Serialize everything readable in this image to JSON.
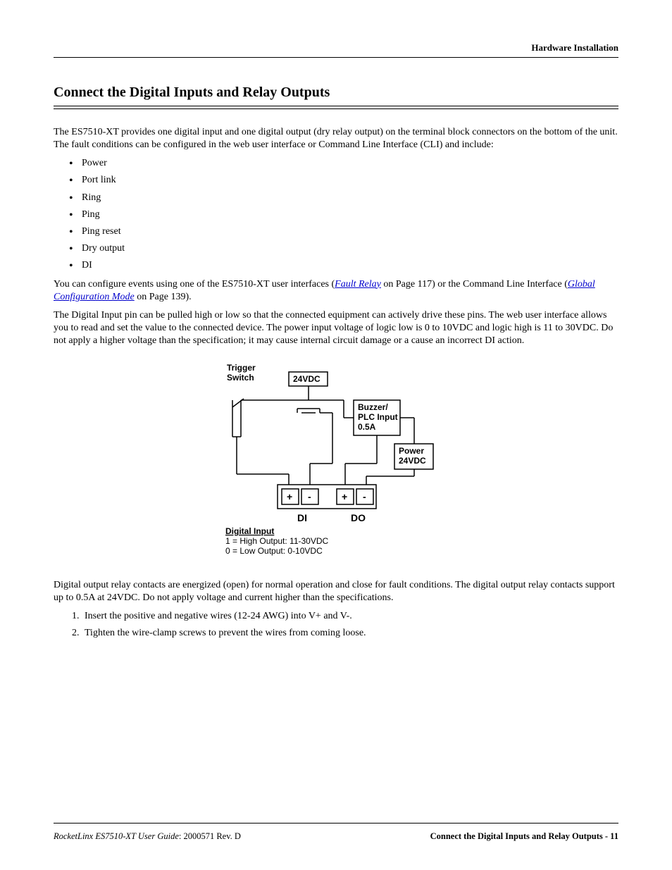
{
  "header": {
    "chapter": "Hardware Installation"
  },
  "section": {
    "title": "Connect the Digital Inputs and Relay Outputs"
  },
  "paras": {
    "intro": "The ES7510-XT provides one digital input and one digital output (dry relay output) on the terminal block connectors on the bottom of the unit. The fault conditions can be configured in the web user interface or Command Line Interface (CLI) and include:",
    "configA": "You can configure events using one of the ES7510-XT user interfaces (",
    "configB": " on Page 117) or the Command Line Interface (",
    "configC": " on Page 139).",
    "digitalInput": "The Digital Input pin can be pulled high or low so that the connected equipment can actively drive these pins. The web user interface allows you to read and set the value to the connected device. The power input voltage of logic low is 0 to 10VDC and logic high is 11 to 30VDC. Do not apply a higher voltage than the specification; it may cause internal circuit damage or a cause an incorrect DI action.",
    "relay": "Digital output relay contacts are energized (open) for normal operation and close for fault conditions. The digital output relay contacts support up to 0.5A at 24VDC. Do not apply voltage and current higher than the specifications."
  },
  "bullets": [
    "Power",
    "Port link",
    "Ring",
    "Ping",
    "Ping reset",
    "Dry output",
    "DI"
  ],
  "links": {
    "faultRelay": "Fault Relay",
    "globalConfig": "Global Configuration Mode"
  },
  "steps": [
    "Insert the positive and negative wires (12-24 AWG) into V+ and V-.",
    "Tighten the wire-clamp screws to prevent the wires from coming loose."
  ],
  "diagram": {
    "triggerSwitch1": "Trigger",
    "triggerSwitch2": "Switch",
    "v24": "24VDC",
    "buzzer1": "Buzzer/",
    "buzzer2": "PLC Input",
    "buzzer3": "0.5A",
    "power1": "Power",
    "power2": "24VDC",
    "plus": "+",
    "minus": "-",
    "di": "DI",
    "do": "DO",
    "diLabel": "Digital Input",
    "diHigh": "1 = High Output: 11-30VDC",
    "diLow": "0 = Low Output:   0-10VDC"
  },
  "footer": {
    "leftItalic": "RocketLinx ES7510-XT  User Guide",
    "leftRev": ": 2000571 Rev. D",
    "right": "Connect the Digital Inputs and Relay Outputs - 11"
  }
}
